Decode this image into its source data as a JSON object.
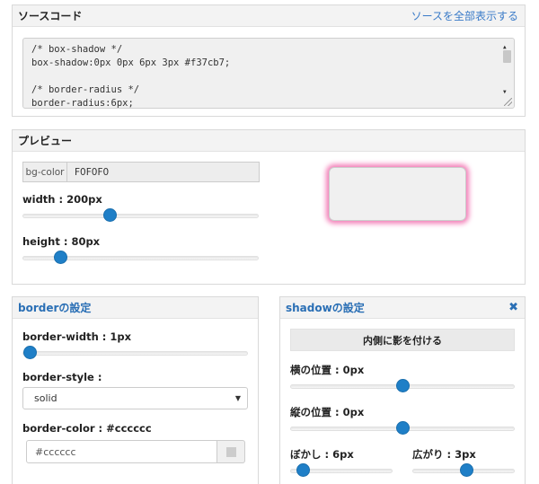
{
  "source": {
    "title": "ソースコード",
    "show_all_link": "ソースを全部表示する",
    "code_lines": [
      "/* box-shadow */",
      "box-shadow:0px 0px 6px 3px #f37cb7;",
      "",
      "/* border-radius */",
      "border-radius:6px;"
    ]
  },
  "preview": {
    "title": "プレビュー",
    "bg_color_label": "bg-color",
    "bg_color_value": "F0F0F0",
    "width_label": "width : 200px",
    "width_value": 200,
    "width_slider_fraction": 0.37,
    "height_label": "height : 80px",
    "height_value": 80,
    "height_slider_fraction": 0.16,
    "box_shadow_color": "#f37cb7",
    "box_background": "#F0F0F0"
  },
  "border_panel": {
    "title": "borderの設定",
    "width_label": "border-width : 1px",
    "width_slider_fraction": 0.03,
    "style_label": "border-style :",
    "style_selected": "solid",
    "color_label": "border-color : #cccccc",
    "color_value": "#cccccc",
    "color_swatch": "#cccccc"
  },
  "shadow_panel": {
    "title": "shadowの設定",
    "close_icon": "close-icon",
    "close_glyph": "✖",
    "inset_button_label": "内側に影を付ける",
    "horizontal_label": "横の位置 : 0px",
    "horizontal_slider_fraction": 0.5,
    "vertical_label": "縦の位置 : 0px",
    "vertical_slider_fraction": 0.5,
    "blur_label": "ぼかし : 6px",
    "blur_slider_fraction": 0.12,
    "spread_label": "広がり : 3px",
    "spread_slider_fraction": 0.53
  },
  "colors": {
    "accent": "#1f7fc7",
    "link": "#3a7bc8",
    "panel_title_blue": "#2a6fb5"
  }
}
